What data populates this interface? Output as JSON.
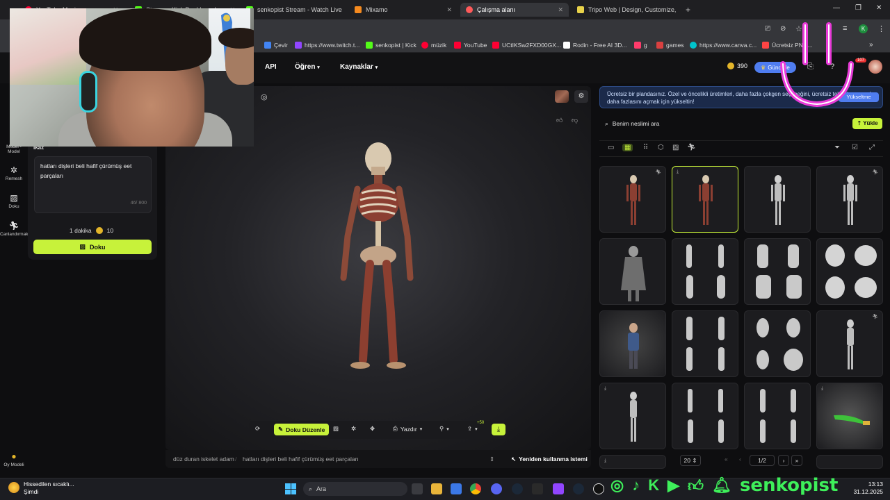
{
  "browser": {
    "tabs": [
      {
        "label": "YouTube Music",
        "color": "#ff0033"
      },
      {
        "label": "Stream - Kick Dashboard",
        "color": "#53fc18"
      },
      {
        "label": "senkopist Stream - Watch Live",
        "color": "#53fc18"
      },
      {
        "label": "Mixamo",
        "color": "#f58a1f"
      },
      {
        "label": "Çalışma alanı",
        "color": "#ff5a5a"
      },
      {
        "label": "Tripo Web | Design, Customize,",
        "color": "#e8d24a"
      }
    ],
    "new_tab": "+",
    "bookmarks": [
      {
        "label": "Çevir",
        "color": "#4285f4"
      },
      {
        "label": "https://www.twitch.t...",
        "color": "#9146ff"
      },
      {
        "label": "senkopist | Kick",
        "color": "#53fc18"
      },
      {
        "label": "müzik",
        "color": "#ff0033"
      },
      {
        "label": "YouTube",
        "color": "#ff0033"
      },
      {
        "label": "UCtIKSw2FXD00GX...",
        "color": "#ff0033"
      },
      {
        "label": "Rodin - Free AI 3D...",
        "color": "#ffffff"
      },
      {
        "label": "g",
        "color": "#ff3b6b"
      },
      {
        "label": "games",
        "color": "#d94040"
      },
      {
        "label": "https://www.canva.c...",
        "color": "#00c4cc"
      },
      {
        "label": "Ücretsiz PNG...",
        "color": "#ff4444"
      }
    ]
  },
  "header": {
    "nav": [
      "API",
      "Öğren",
      "Kaynaklar"
    ],
    "credits": "390",
    "upgrade": "Güncelle",
    "notification_count": "107"
  },
  "rail": {
    "items": [
      "Model - Model",
      "Remesh",
      "Doku",
      "Canlandırmak"
    ],
    "bottom": "Oy Modeli"
  },
  "tool": {
    "section": "İkaz",
    "prompt": "hatları dişleri beli hafif çürümüş eet parçaları",
    "counter": "46/ 800",
    "time": "1 dakika",
    "cost": "10",
    "action": "Doku"
  },
  "viewport": {
    "toolbar": {
      "edit_texture": "Doku Düzenle",
      "print": "Yazdır",
      "plus_badge": "+50"
    },
    "breadcrumb": [
      "düz duran iskelet adam",
      "hatları dişleri beli hafif çürümüş eet parçaları"
    ],
    "reuse": "Yeniden kullanma istemi"
  },
  "library": {
    "notice": "Ücretsiz bir plandasınız. Özel ve öncelikli üretimleri, daha fazla çokgen seçeneğini, ücretsiz tekrarları ve çok daha fazlasını açmak için yükseltin!",
    "notice_btn": "Yükseltme",
    "search_placeholder": "Benim neslimi ara",
    "upload": "Yükle",
    "page_size": "20",
    "page": "1/2"
  },
  "taskbar": {
    "weather_title": "Hissedilen sıcaklı...",
    "weather_sub": "Şimdi",
    "search": "Ara",
    "time": "13:13",
    "date": "31.12.2025"
  },
  "overlay": {
    "brand": "senkopist",
    "brand_color": "#3ef05a",
    "logo_color": "#e83ad8"
  }
}
